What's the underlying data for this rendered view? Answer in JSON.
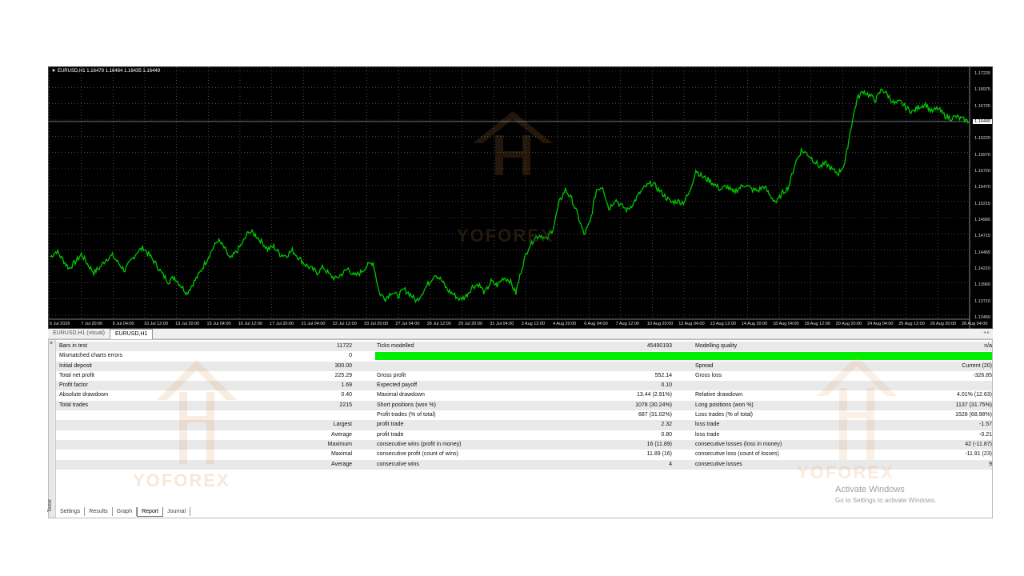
{
  "chart": {
    "header": "EURUSD,H1  1.16479 1.16484 1.16435 1.16449",
    "current_price": "1.16449",
    "price_labels": [
      "1.17225",
      "1.16975",
      "1.16725",
      "1.16449",
      "1.16220",
      "1.15970",
      "1.15720",
      "1.15470",
      "1.15215",
      "1.14965",
      "1.14715",
      "1.14465",
      "1.14210",
      "1.13960",
      "1.13710",
      "1.13460"
    ],
    "time_labels": [
      "6 Jul 2026",
      "7 Jul 20:00",
      "9 Jul 04:00",
      "10 Jul 12:00",
      "13 Jul 20:00",
      "15 Jul 04:00",
      "16 Jul 12:00",
      "17 Jul 20:00",
      "21 Jul 04:00",
      "22 Jul 12:00",
      "23 Jul 20:00",
      "27 Jul 04:00",
      "28 Jul 12:00",
      "29 Jul 20:00",
      "31 Jul 04:00",
      "3 Aug 12:00",
      "4 Aug 20:00",
      "6 Aug 04:00",
      "7 Aug 12:00",
      "10 Aug 20:00",
      "12 Aug 04:00",
      "13 Aug 12:00",
      "14 Aug 20:00",
      "18 Aug 04:00",
      "19 Aug 12:00",
      "20 Aug 20:00",
      "24 Aug 04:00",
      "25 Aug 12:00",
      "26 Aug 20:00",
      "28 Aug 04:00"
    ],
    "line_color": "#00c800",
    "background": "#000000",
    "series": [
      1.1436,
      1.1445,
      1.1432,
      1.1418,
      1.1428,
      1.144,
      1.1425,
      1.1412,
      1.142,
      1.1433,
      1.1438,
      1.1426,
      1.1415,
      1.143,
      1.1444,
      1.145,
      1.1438,
      1.1425,
      1.141,
      1.1398,
      1.1405,
      1.1392,
      1.138,
      1.1395,
      1.141,
      1.1428,
      1.1446,
      1.1462,
      1.145,
      1.1432,
      1.1444,
      1.1458,
      1.1476,
      1.147,
      1.146,
      1.1448,
      1.1452,
      1.144,
      1.1438,
      1.1446,
      1.1435,
      1.1425,
      1.1418,
      1.1412,
      1.142,
      1.1408,
      1.1402,
      1.141,
      1.1418,
      1.1406,
      1.1412,
      1.1422,
      1.1428,
      1.138,
      1.1372,
      1.1382,
      1.1375,
      1.1386,
      1.1378,
      1.1368,
      1.1382,
      1.1396,
      1.141,
      1.14,
      1.1385,
      1.1378,
      1.137,
      1.1376,
      1.139,
      1.1394,
      1.138,
      1.1398,
      1.1392,
      1.1404,
      1.14,
      1.138,
      1.142,
      1.145,
      1.1465,
      1.147,
      1.1462,
      1.148,
      1.152,
      1.154,
      1.1525,
      1.15,
      1.147,
      1.149,
      1.154,
      1.1545,
      1.151,
      1.1525,
      1.1515,
      1.1508,
      1.152,
      1.1535,
      1.1545,
      1.155,
      1.154,
      1.153,
      1.152,
      1.1522,
      1.152,
      1.1535,
      1.157,
      1.156,
      1.1555,
      1.1548,
      1.154,
      1.1545,
      1.1535,
      1.1542,
      1.1548,
      1.154,
      1.1538,
      1.1545,
      1.153,
      1.152,
      1.1535,
      1.1545,
      1.158,
      1.16,
      1.1595,
      1.1585,
      1.1575,
      1.158,
      1.157,
      1.1565,
      1.158,
      1.1635,
      1.168,
      1.1692,
      1.1685,
      1.1678,
      1.1695,
      1.1685,
      1.1672,
      1.1675,
      1.1665,
      1.166,
      1.1668,
      1.1672,
      1.166,
      1.1665,
      1.1655,
      1.165,
      1.1652,
      1.1648,
      1.1645
    ]
  },
  "chart_tabs": [
    "EURUSD,H1 (visual)",
    "EURUSD,H1"
  ],
  "tester": {
    "side_label": "Tester",
    "close": "×",
    "rows": [
      {
        "c1": "Bars in test",
        "c2": "11722",
        "c3": "Ticks modelled",
        "c4": "45490193",
        "c5": "Modelling quality",
        "c6": "n/a"
      },
      {
        "c1": "Mismatched charts errors",
        "c2": "0",
        "c3": "",
        "c4": "",
        "c5": "",
        "c6": ""
      },
      {
        "c1": "Initial deposit",
        "c2": "300.00",
        "c3": "",
        "c4": "",
        "c5": "Spread",
        "c6": "Current (20)"
      },
      {
        "c1": "Total net profit",
        "c2": "225.29",
        "c3": "Gross profit",
        "c4": "552.14",
        "c5": "Gross loss",
        "c6": "-326.85"
      },
      {
        "c1": "Profit factor",
        "c2": "1.69",
        "c3": "Expected payoff",
        "c4": "0.10",
        "c5": "",
        "c6": ""
      },
      {
        "c1": "Absolute drawdown",
        "c2": "0.40",
        "c3": "Maximal drawdown",
        "c4": "13.44 (2.91%)",
        "c5": "Relative drawdown",
        "c6": "4.01% (12.63)"
      },
      {
        "c1": "Total trades",
        "c2": "2215",
        "c3": "Short positions (won %)",
        "c4": "1078 (30.24%)",
        "c5": "Long positions (won %)",
        "c6": "1137 (31.75%)"
      },
      {
        "c1": "",
        "c2": "",
        "c3": "Profit trades (% of total)",
        "c4": "687 (31.02%)",
        "c5": "Loss trades (% of total)",
        "c6": "1528 (68.98%)"
      },
      {
        "c1": "",
        "c2": "Largest",
        "c3": "profit trade",
        "c4": "2.32",
        "c5": "loss trade",
        "c6": "-1.57"
      },
      {
        "c1": "",
        "c2": "Average",
        "c3": "profit trade",
        "c4": "0.80",
        "c5": "loss trade",
        "c6": "-0.21"
      },
      {
        "c1": "",
        "c2": "Maximum",
        "c3": "consecutive wins (profit in money)",
        "c4": "16 (11.89)",
        "c5": "consecutive losses (loss in money)",
        "c6": "42 (-11.87)"
      },
      {
        "c1": "",
        "c2": "Maximal",
        "c3": "consecutive profit (count of wins)",
        "c4": "11.89 (16)",
        "c5": "consecutive loss (count of losses)",
        "c6": "-11.91 (23)"
      },
      {
        "c1": "",
        "c2": "Average",
        "c3": "consecutive wins",
        "c4": "4",
        "c5": "consecutive losses",
        "c6": "9"
      }
    ],
    "quality_bar_color": "#00ee00",
    "tabs": [
      "Settings",
      "Results",
      "Graph",
      "Report",
      "Journal"
    ],
    "active_tab": "Report"
  },
  "watermark": {
    "text": "YOFOREX"
  },
  "os_notice": {
    "title": "Activate Windows",
    "subtitle": "Go to Settings to activate Windows."
  }
}
